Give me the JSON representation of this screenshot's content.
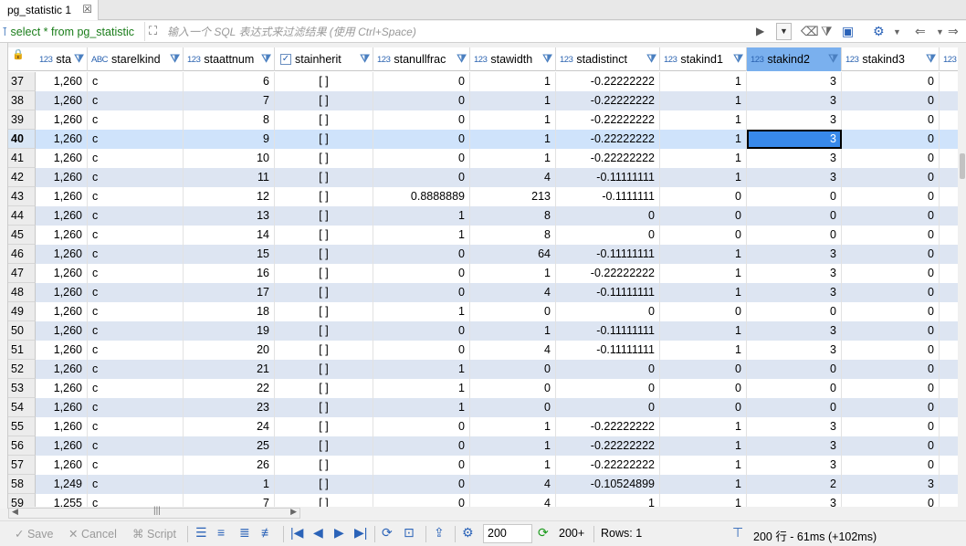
{
  "tab": {
    "title": "pg_statistic 1",
    "close": "☒"
  },
  "filter": {
    "query": "select * from pg_statistic",
    "placeholder": "输入一个 SQL 表达式来过滤结果 (使用 Ctrl+Space)"
  },
  "columns": [
    {
      "name": "sta",
      "type": "123"
    },
    {
      "name": "starelkind",
      "type": "ABC"
    },
    {
      "name": "staattnum",
      "type": "123"
    },
    {
      "name": "stainherit",
      "type": "check"
    },
    {
      "name": "stanullfrac",
      "type": "123"
    },
    {
      "name": "stawidth",
      "type": "123"
    },
    {
      "name": "stadistinct",
      "type": "123"
    },
    {
      "name": "stakind1",
      "type": "123"
    },
    {
      "name": "stakind2",
      "type": "123"
    },
    {
      "name": "stakind3",
      "type": "123"
    },
    {
      "name": "",
      "type": "123"
    }
  ],
  "rows": [
    [
      "37",
      "1,260",
      "c",
      "6",
      "[ ]",
      "0",
      "1",
      "-0.22222222",
      "1",
      "3",
      "0"
    ],
    [
      "38",
      "1,260",
      "c",
      "7",
      "[ ]",
      "0",
      "1",
      "-0.22222222",
      "1",
      "3",
      "0"
    ],
    [
      "39",
      "1,260",
      "c",
      "8",
      "[ ]",
      "0",
      "1",
      "-0.22222222",
      "1",
      "3",
      "0"
    ],
    [
      "40",
      "1,260",
      "c",
      "9",
      "[ ]",
      "0",
      "1",
      "-0.22222222",
      "1",
      "3",
      "0"
    ],
    [
      "41",
      "1,260",
      "c",
      "10",
      "[ ]",
      "0",
      "1",
      "-0.22222222",
      "1",
      "3",
      "0"
    ],
    [
      "42",
      "1,260",
      "c",
      "11",
      "[ ]",
      "0",
      "4",
      "-0.11111111",
      "1",
      "3",
      "0"
    ],
    [
      "43",
      "1,260",
      "c",
      "12",
      "[ ]",
      "0.8888889",
      "213",
      "-0.1111111",
      "0",
      "0",
      "0"
    ],
    [
      "44",
      "1,260",
      "c",
      "13",
      "[ ]",
      "1",
      "8",
      "0",
      "0",
      "0",
      "0"
    ],
    [
      "45",
      "1,260",
      "c",
      "14",
      "[ ]",
      "1",
      "8",
      "0",
      "0",
      "0",
      "0"
    ],
    [
      "46",
      "1,260",
      "c",
      "15",
      "[ ]",
      "0",
      "64",
      "-0.11111111",
      "1",
      "3",
      "0"
    ],
    [
      "47",
      "1,260",
      "c",
      "16",
      "[ ]",
      "0",
      "1",
      "-0.22222222",
      "1",
      "3",
      "0"
    ],
    [
      "48",
      "1,260",
      "c",
      "17",
      "[ ]",
      "0",
      "4",
      "-0.11111111",
      "1",
      "3",
      "0"
    ],
    [
      "49",
      "1,260",
      "c",
      "18",
      "[ ]",
      "1",
      "0",
      "0",
      "0",
      "0",
      "0"
    ],
    [
      "50",
      "1,260",
      "c",
      "19",
      "[ ]",
      "0",
      "1",
      "-0.11111111",
      "1",
      "3",
      "0"
    ],
    [
      "51",
      "1,260",
      "c",
      "20",
      "[ ]",
      "0",
      "4",
      "-0.11111111",
      "1",
      "3",
      "0"
    ],
    [
      "52",
      "1,260",
      "c",
      "21",
      "[ ]",
      "1",
      "0",
      "0",
      "0",
      "0",
      "0"
    ],
    [
      "53",
      "1,260",
      "c",
      "22",
      "[ ]",
      "1",
      "0",
      "0",
      "0",
      "0",
      "0"
    ],
    [
      "54",
      "1,260",
      "c",
      "23",
      "[ ]",
      "1",
      "0",
      "0",
      "0",
      "0",
      "0"
    ],
    [
      "55",
      "1,260",
      "c",
      "24",
      "[ ]",
      "0",
      "1",
      "-0.22222222",
      "1",
      "3",
      "0"
    ],
    [
      "56",
      "1,260",
      "c",
      "25",
      "[ ]",
      "0",
      "1",
      "-0.22222222",
      "1",
      "3",
      "0"
    ],
    [
      "57",
      "1,260",
      "c",
      "26",
      "[ ]",
      "0",
      "1",
      "-0.22222222",
      "1",
      "3",
      "0"
    ],
    [
      "58",
      "1,249",
      "c",
      "1",
      "[ ]",
      "0",
      "4",
      "-0.10524899",
      "1",
      "2",
      "3"
    ],
    [
      "59",
      "1,255",
      "c",
      "7",
      "[ ]",
      "0",
      "4",
      "1",
      "1",
      "3",
      "0"
    ]
  ],
  "current_row": "40",
  "bottom": {
    "save": "Save",
    "cancel": "Cancel",
    "script": "Script",
    "fetch_size": "200",
    "fetch_more": "200+",
    "rows": "Rows: 1",
    "status": "200 行 - 61ms (+102ms)"
  },
  "colors": {
    "accent": "#3889ea",
    "selected_header": "#7ab0ee",
    "alt_row": "#dde5f2",
    "query_text": "#1a7d1a"
  }
}
